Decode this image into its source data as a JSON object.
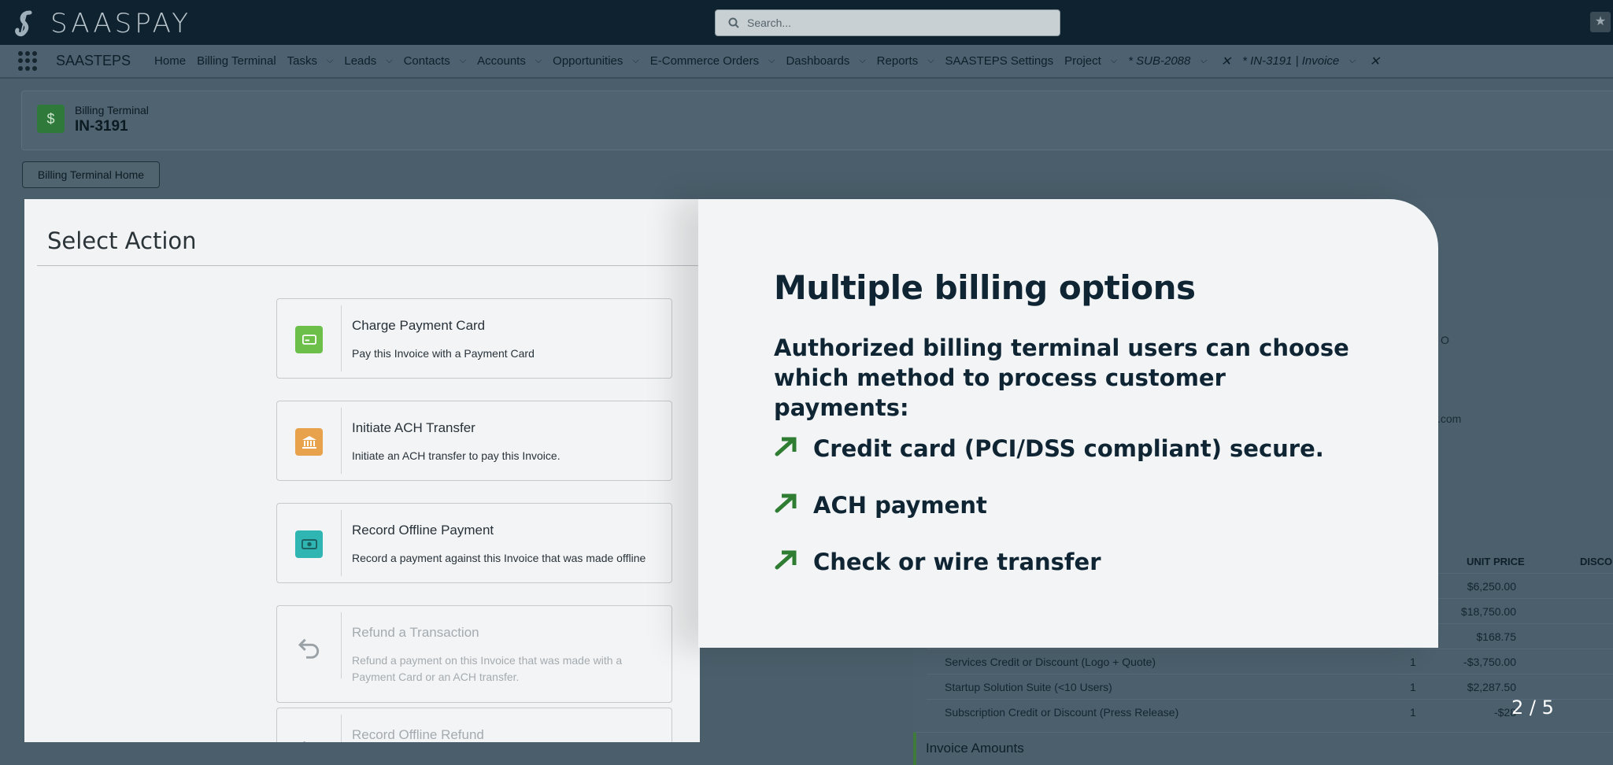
{
  "header": {
    "logo_text": "SAASPAY",
    "search_placeholder": "Search..."
  },
  "nav": {
    "app_name": "SAASTEPS",
    "items": [
      {
        "label": "Home",
        "chevron": false
      },
      {
        "label": "Billing Terminal",
        "chevron": false
      },
      {
        "label": "Tasks",
        "chevron": true
      },
      {
        "label": "Leads",
        "chevron": true
      },
      {
        "label": "Contacts",
        "chevron": true
      },
      {
        "label": "Accounts",
        "chevron": true
      },
      {
        "label": "Opportunities",
        "chevron": true
      },
      {
        "label": "E-Commerce Orders",
        "chevron": true
      },
      {
        "label": "Dashboards",
        "chevron": true
      },
      {
        "label": "Reports",
        "chevron": true
      },
      {
        "label": "SAASTEPS Settings",
        "chevron": false
      },
      {
        "label": "Project",
        "chevron": true
      }
    ],
    "tabs": [
      {
        "label": "* SUB-2088"
      },
      {
        "label": "* IN-3191 | Invoice"
      }
    ]
  },
  "record": {
    "object": "Billing Terminal",
    "name": "IN-3191",
    "home_button": "Billing Terminal Home"
  },
  "modal": {
    "title": "Select Action",
    "options": [
      {
        "title": "Charge Payment Card",
        "desc": "Pay this Invoice with a Payment Card",
        "color": "#6cc04a",
        "icon": "card-icon",
        "disabled": false
      },
      {
        "title": "Initiate ACH Transfer",
        "desc": "Initiate an ACH transfer to pay this Invoice.",
        "color": "#e8a24c",
        "icon": "bank-icon",
        "disabled": false
      },
      {
        "title": "Record Offline Payment",
        "desc": "Record a payment against this Invoice that was made offline",
        "color": "#2fb6b3",
        "icon": "cash-icon",
        "disabled": false
      },
      {
        "title": "Refund a Transaction",
        "desc": "Refund a payment on this Invoice that was made with a Payment Card or an ACH transfer.",
        "color": "#9aa2a7",
        "icon": "undo-icon",
        "disabled": true
      },
      {
        "title": "Record Offline Refund",
        "desc": "",
        "color": "#9aa2a7",
        "icon": "undo-icon",
        "disabled": true
      }
    ]
  },
  "tour": {
    "title": "Multiple billing options",
    "intro": "Authorized billing terminal users can choose which method to process customer payments:",
    "bullets": [
      "Credit card (PCI/DSS compliant) secure.",
      "ACH payment",
      "Check or wire transfer"
    ],
    "accent": "#2e7d32",
    "pager": "2 / 5"
  },
  "background_table": {
    "header_unit_price": "UNIT PRICE",
    "header_disc": "DISCO",
    "rows": [
      {
        "name": "",
        "qty": "",
        "price": "$6,250.00"
      },
      {
        "name": "",
        "qty": "",
        "price": "$18,750.00"
      },
      {
        "name": "",
        "qty": "",
        "price": "$168.75"
      },
      {
        "name": "Services Credit or Discount (Logo + Quote)",
        "qty": "1",
        "price": "-$3,750.00"
      },
      {
        "name": "Startup Solution Suite (<10 Users)",
        "qty": "1",
        "price": "$2,287.50"
      },
      {
        "name": "Subscription Credit or Discount (Press Release)",
        "qty": "1",
        "price": "-$28"
      }
    ],
    "section": "Invoice Amounts",
    "fragments": [
      "O",
      ".com"
    ]
  }
}
